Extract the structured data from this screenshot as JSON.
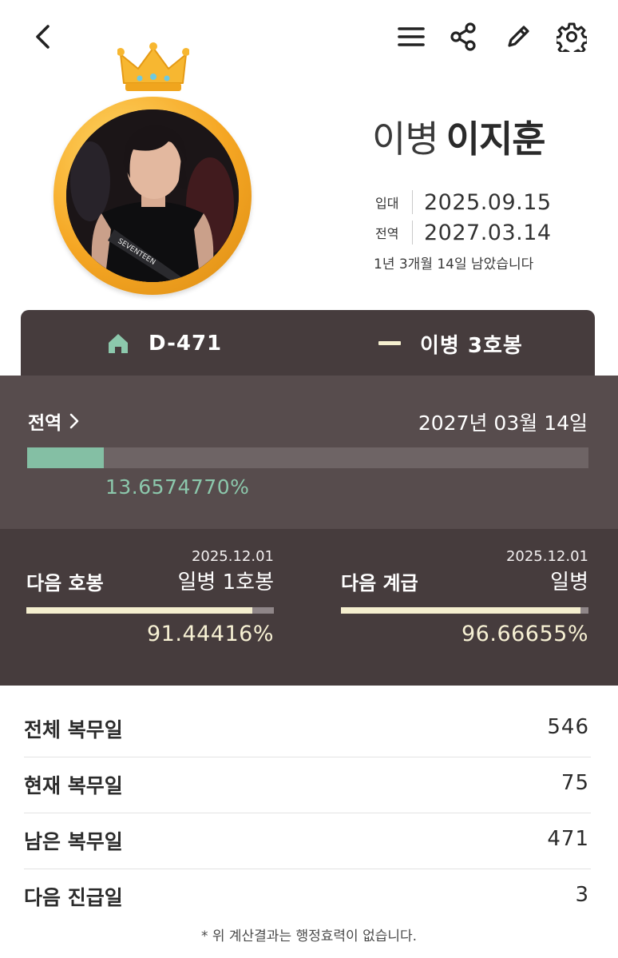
{
  "header": {
    "icons": [
      "back-icon",
      "menu-icon",
      "share-icon",
      "edit-icon",
      "settings-icon"
    ]
  },
  "profile": {
    "rank": "이병",
    "name": "이지훈",
    "enlist_label": "입대",
    "enlist_date": "2025.09.15",
    "discharge_label": "전역",
    "discharge_date": "2027.03.14",
    "remaining_text": "1년 3개월 14일 남았습니다",
    "avatar_shirt_text": "SEVENTEEN"
  },
  "summary": {
    "d_day": "D-471",
    "current_grade": "이병 3호봉"
  },
  "discharge_progress": {
    "label": "전역",
    "date": "2027년 03월 14일",
    "percent_text": "13.6574770%",
    "fraction": 0.13657477
  },
  "next": {
    "pay_step": {
      "title": "다음 호봉",
      "date": "2025.12.01",
      "name": "일병 1호봉",
      "percent_text": "91.44416%",
      "fraction": 0.9144416
    },
    "grade": {
      "title": "다음 계급",
      "date": "2025.12.01",
      "name": "일병",
      "percent_text": "96.66655%",
      "fraction": 0.9666655
    }
  },
  "stats": [
    {
      "label": "전체 복무일",
      "value": "546"
    },
    {
      "label": "현재 복무일",
      "value": "75"
    },
    {
      "label": "남은 복무일",
      "value": "471"
    },
    {
      "label": "다음 진급일",
      "value": "3"
    }
  ],
  "footnote": "* 위 계산결과는 행정효력이 없습니다.",
  "colors": {
    "card_dark": "#463c3d",
    "card_mid": "#574c4d",
    "progress_green": "#84bfa4",
    "progress_cream": "#f5efcf",
    "medal_gold": "#f5a623"
  }
}
